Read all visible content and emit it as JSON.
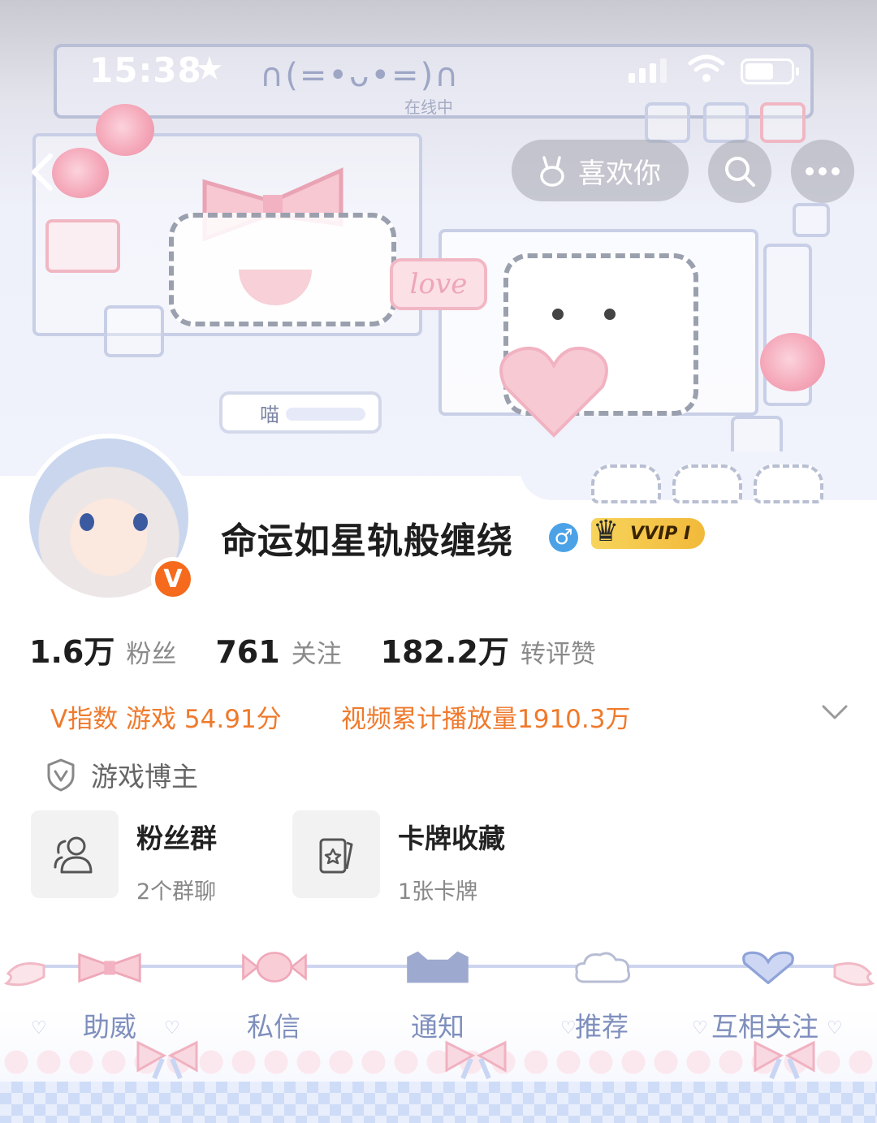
{
  "status_bar": {
    "time": "15:38",
    "kaomoji": "∩(=•ᴗ•=)∩",
    "online_text": "在线中"
  },
  "header": {
    "like_button_label": "喜欢你",
    "icons": [
      "back-arrow-icon",
      "bunny-icon",
      "search-icon",
      "more-icon"
    ],
    "meow_text": "喵",
    "love_text": "love"
  },
  "profile": {
    "username": "命运如星轨般缠绕",
    "gender_symbol": "♂",
    "vip_label": "VVIP I",
    "verified_badge": "V"
  },
  "stats": [
    {
      "value": "1.6万",
      "label": "粉丝"
    },
    {
      "value": "761",
      "label": "关注"
    },
    {
      "value": "182.2万",
      "label": "转评赞"
    }
  ],
  "info": {
    "v_index": "V指数 游戏 54.91分",
    "play_count": "视频累计播放量1910.3万",
    "certification": "游戏博主"
  },
  "cards": [
    {
      "title": "粉丝群",
      "subtitle": "2个群聊",
      "icon": "group-icon"
    },
    {
      "title": "卡牌收藏",
      "subtitle": "1张卡牌",
      "icon": "card-icon"
    }
  ],
  "tabs": [
    "助威",
    "私信",
    "通知",
    "推荐",
    "互相关注"
  ],
  "colors": {
    "accent_orange": "#ef7a2c",
    "verified_orange": "#f56a1c",
    "gender_blue": "#4ba2e6",
    "vip_gold": "#f2b93a",
    "tab_text": "#7f8fbd"
  }
}
